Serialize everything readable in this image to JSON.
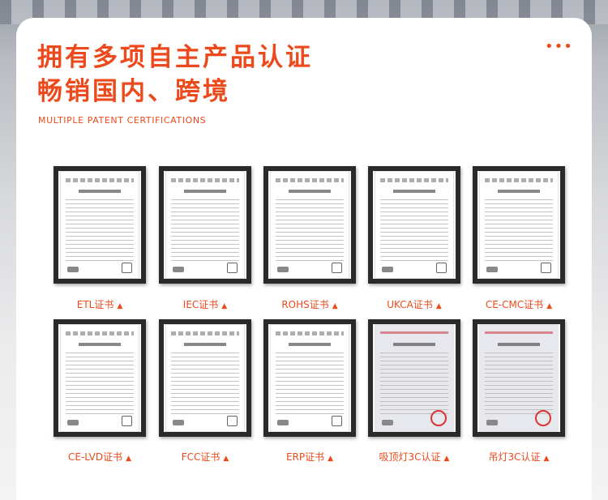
{
  "header": {
    "title_line1": "拥有多项自主产品认证",
    "title_line2": "畅销国内、跨境",
    "subtitle": "MULTIPLE PATENT CERTIFICATIONS",
    "dots": "•••"
  },
  "certificates": {
    "row1": [
      {
        "label": "ETL证书",
        "arrow": "▲"
      },
      {
        "label": "IEC证书",
        "arrow": "▲"
      },
      {
        "label": "ROHS证书",
        "arrow": "▲"
      },
      {
        "label": "UKCA证书",
        "arrow": "▲"
      },
      {
        "label": "CE-CMC证书",
        "arrow": "▲"
      }
    ],
    "row2": [
      {
        "label": "CE-LVD证书",
        "arrow": "▲"
      },
      {
        "label": "FCC证书",
        "arrow": "▲"
      },
      {
        "label": "ERP证书",
        "arrow": "▲"
      },
      {
        "label": "吸顶灯3C认证",
        "arrow": "▲"
      },
      {
        "label": "吊灯3C认证",
        "arrow": "▲"
      }
    ]
  },
  "colors": {
    "accent": "#ec4a1c",
    "frame": "#2a2a2a"
  }
}
